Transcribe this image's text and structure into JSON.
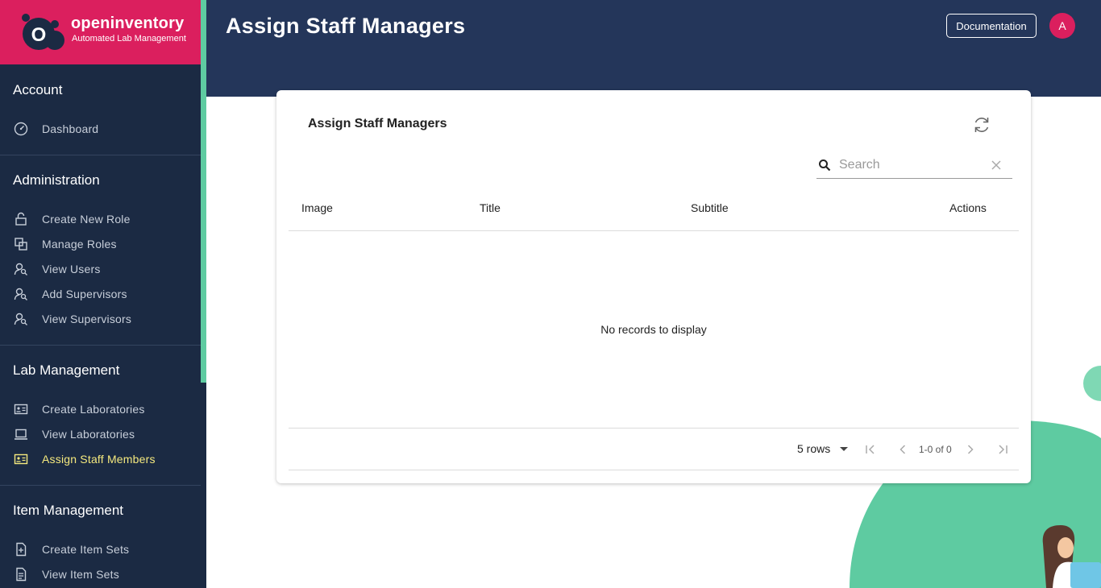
{
  "brand": {
    "name": "openinventory",
    "tagline": "Automated Lab Management",
    "logo_letter": "O"
  },
  "sidebar": {
    "sections": [
      {
        "title": "Account",
        "items": [
          {
            "label": "Dashboard",
            "icon": "dashboard-icon"
          }
        ]
      },
      {
        "title": "Administration",
        "items": [
          {
            "label": "Create New Role",
            "icon": "lock-icon"
          },
          {
            "label": "Manage Roles",
            "icon": "roles-icon"
          },
          {
            "label": "View Users",
            "icon": "user-search-icon"
          },
          {
            "label": "Add Supervisors",
            "icon": "user-search-icon"
          },
          {
            "label": "View Supervisors",
            "icon": "user-search-icon"
          }
        ]
      },
      {
        "title": "Lab Management",
        "items": [
          {
            "label": "Create Laboratories",
            "icon": "id-card-icon"
          },
          {
            "label": "View Laboratories",
            "icon": "laptop-icon"
          },
          {
            "label": "Assign Staff Members",
            "icon": "id-card-icon",
            "active": true
          }
        ]
      },
      {
        "title": "Item Management",
        "items": [
          {
            "label": "Create Item Sets",
            "icon": "document-icon"
          },
          {
            "label": "View Item Sets",
            "icon": "document-icon"
          }
        ]
      }
    ]
  },
  "header": {
    "title": "Assign Staff Managers",
    "documentation_label": "Documentation",
    "avatar_initial": "A"
  },
  "card": {
    "title": "Assign Staff Managers",
    "search": {
      "placeholder": "Search",
      "value": ""
    },
    "columns": [
      "Image",
      "Title",
      "Subtitle",
      "Actions"
    ],
    "rows": [],
    "empty_message": "No records to display",
    "pagination": {
      "rows_per_page": "5 rows",
      "range": "1-0 of 0"
    }
  },
  "colors": {
    "sidebar_bg": "#1b2a43",
    "header_bg": "#24365a",
    "brand_pink": "#db1f5e",
    "accent_green": "#5ecba1",
    "active_nav": "#f5e97e"
  }
}
